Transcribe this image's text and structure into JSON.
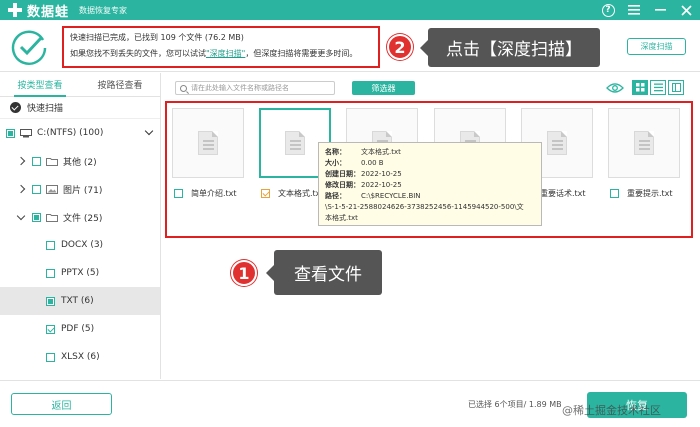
{
  "app": {
    "name": "数据蛙",
    "subtitle": "数据恢复专家"
  },
  "scan_info": {
    "line1": "快速扫描已完成，已找到 109 个文件 (76.2 MB)",
    "line2_prefix": "如果您找不到丢失的文件，您可以试试",
    "line2_link": "\"深度扫描\"",
    "line2_suffix": "，但深度扫描将需要更多时间。",
    "deep_scan_button": "深度扫描"
  },
  "annotations": {
    "badge2": "2",
    "callout2": "点击【深度扫描】",
    "badge1": "1",
    "callout1": "查看文件"
  },
  "sidebar": {
    "tabs": [
      "按类型查看",
      "按路径查看"
    ],
    "quick_scan": "快速扫描",
    "tree": [
      {
        "label": "C:(NTFS) (100)"
      },
      {
        "label": "其他 (2)"
      },
      {
        "label": "图片 (71)"
      },
      {
        "label": "文件 (25)"
      },
      {
        "label": "DOCX (3)"
      },
      {
        "label": "PPTX (5)"
      },
      {
        "label": "TXT (6)"
      },
      {
        "label": "PDF (5)"
      },
      {
        "label": "XLSX (6)"
      }
    ]
  },
  "toolbar": {
    "search_placeholder": "请在此处输入文件名称或路径名",
    "filter_button": "筛选器"
  },
  "files": [
    {
      "name": "简单介绍.txt"
    },
    {
      "name": "文本格式.txt"
    },
    {
      "name": ""
    },
    {
      "name": ""
    },
    {
      "name": "重要话术.txt"
    },
    {
      "name": "重要提示.txt"
    }
  ],
  "tooltip": {
    "name_key": "名称：",
    "name_val": "文本格式.txt",
    "size_key": "大小：",
    "size_val": "0.00 B",
    "created_key": "创建日期：",
    "created_val": "2022-10-25",
    "modified_key": "修改日期：",
    "modified_val": "2022-10-25",
    "path_key": "路径：",
    "path_line1": "C:\\$RECYCLE.BIN",
    "path_line2": "\\S-1-5-21-2588024626-3738252456-1145944520-500\\文",
    "path_line3": "本格式.txt"
  },
  "footer": {
    "back_button": "返回",
    "status": "已选择 6个项目/ 1.89 MB",
    "recover_button": "恢复",
    "watermark": "@稀土掘金技术社区"
  },
  "colors": {
    "accent": "#2bb5a0",
    "highlight_red": "#e02020"
  }
}
